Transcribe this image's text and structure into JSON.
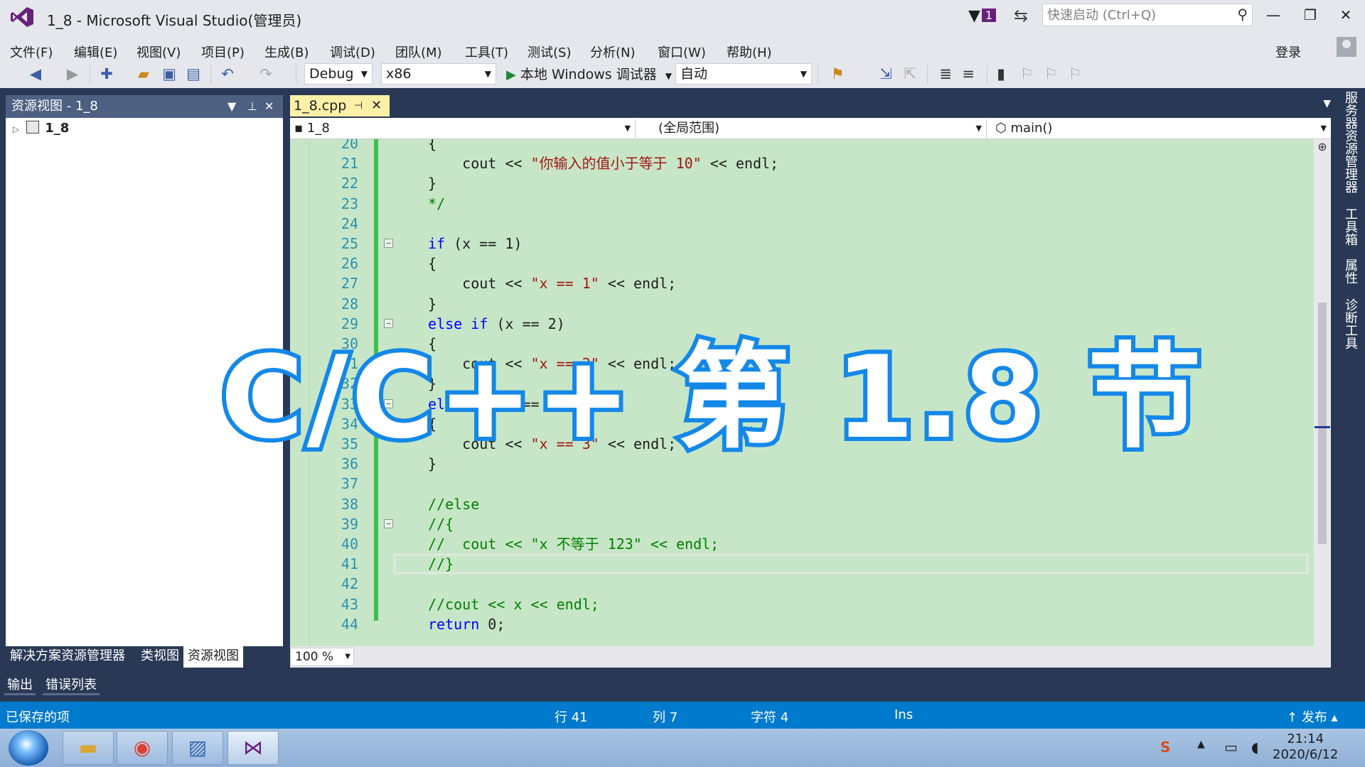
{
  "window": {
    "title": "1_8 - Microsoft Visual Studio(管理员)",
    "notification_count": "1",
    "quick_launch_placeholder": "快速启动 (Ctrl+Q)",
    "login": "登录"
  },
  "menu": [
    "文件(F)",
    "编辑(E)",
    "视图(V)",
    "项目(P)",
    "生成(B)",
    "调试(D)",
    "团队(M)",
    "工具(T)",
    "测试(S)",
    "分析(N)",
    "窗口(W)",
    "帮助(H)"
  ],
  "toolbar": {
    "config": "Debug",
    "platform": "x86",
    "debugger": "本地 Windows 调试器",
    "auto": "自动"
  },
  "left_panel": {
    "title": "资源视图 - 1_8",
    "tree_root": "1_8",
    "tabs": [
      "解决方案资源管理器",
      "类视图",
      "资源视图"
    ],
    "active_tab": "资源视图"
  },
  "editor": {
    "tab": "1_8.cpp",
    "nav_project": "1_8",
    "nav_scope": "(全局范围)",
    "nav_function": "main()",
    "zoom": "100 %",
    "lines": [
      {
        "n": "20",
        "text": "{"
      },
      {
        "n": "21",
        "text": "    cout << \"你输入的值小于等于 10\" << endl;"
      },
      {
        "n": "22",
        "text": "}"
      },
      {
        "n": "23",
        "text": "*/"
      },
      {
        "n": "24",
        "text": ""
      },
      {
        "n": "25",
        "text": "if (x == 1)"
      },
      {
        "n": "26",
        "text": "{"
      },
      {
        "n": "27",
        "text": "    cout << \"x == 1\" << endl;"
      },
      {
        "n": "28",
        "text": "}"
      },
      {
        "n": "29",
        "text": "else if (x == 2)"
      },
      {
        "n": "30",
        "text": "{"
      },
      {
        "n": "31",
        "text": "    cout << \"x == 2\" << endl;"
      },
      {
        "n": "32",
        "text": "}"
      },
      {
        "n": "33",
        "text": "else if (x == 3)"
      },
      {
        "n": "34",
        "text": "{"
      },
      {
        "n": "35",
        "text": "    cout << \"x == 3\" << endl;"
      },
      {
        "n": "36",
        "text": "}"
      },
      {
        "n": "37",
        "text": ""
      },
      {
        "n": "38",
        "text": "//else"
      },
      {
        "n": "39",
        "text": "//{"
      },
      {
        "n": "40",
        "text": "//  cout << \"x 不等于 123\" << endl;"
      },
      {
        "n": "41",
        "text": "//}"
      },
      {
        "n": "42",
        "text": ""
      },
      {
        "n": "43",
        "text": "//cout << x << endl;"
      },
      {
        "n": "44",
        "text": "return 0;"
      }
    ]
  },
  "side_tabs": [
    "服务器资源管理器",
    "工具箱",
    "属性",
    "诊断工具"
  ],
  "output_tabs": [
    "输出",
    "错误列表"
  ],
  "status": {
    "message": "已保存的项",
    "line": "行 41",
    "col": "列 7",
    "char": "字符 4",
    "mode": "Ins",
    "publish": "发布"
  },
  "taskbar": {
    "time": "21:14",
    "date": "2020/6/12"
  },
  "overlay_title": "C/C++ 第 1.8 节",
  "colors": {
    "status_bar": "#007acc",
    "editor_bg": "#c7e6c7",
    "overlay_stroke": "#1488e8",
    "panel_title": "#4d6082"
  }
}
